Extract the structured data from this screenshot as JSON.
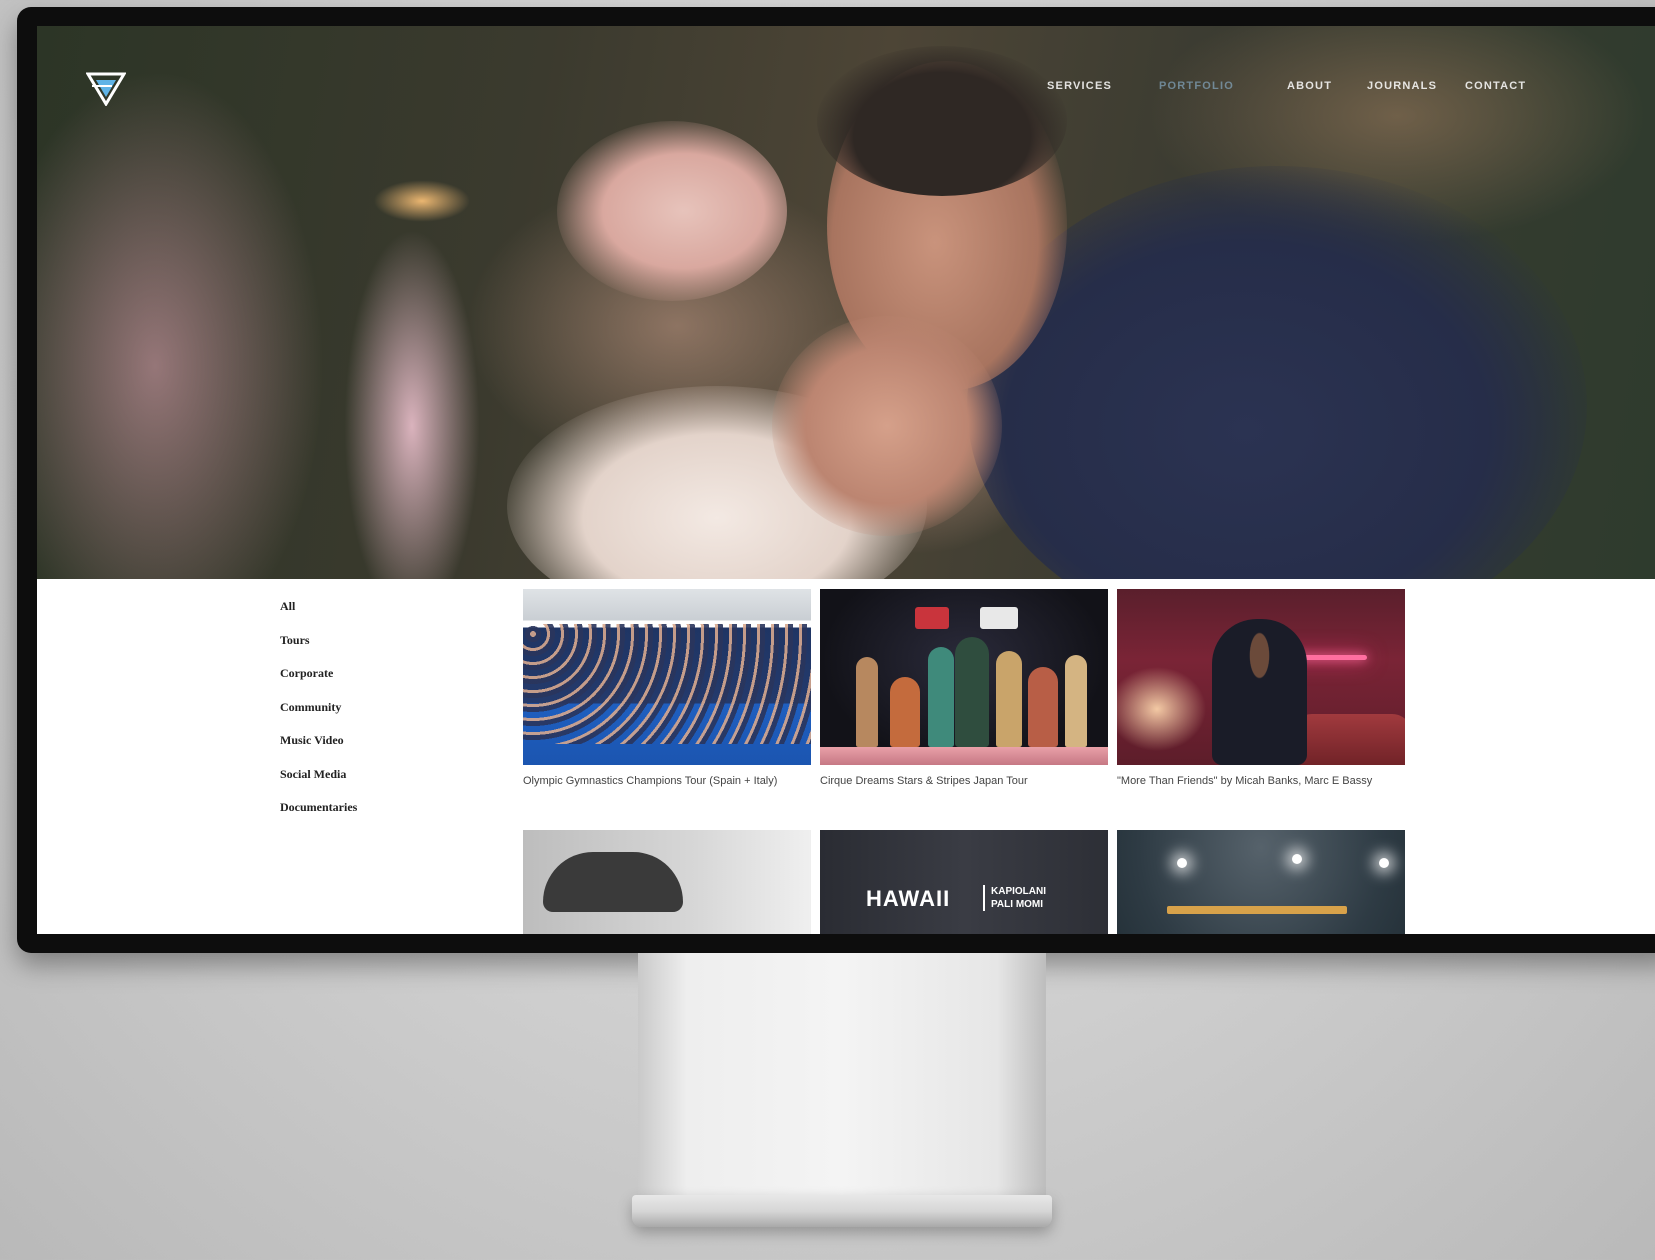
{
  "nav": {
    "items": [
      {
        "label": "SERVICES"
      },
      {
        "label": "PORTFOLIO"
      },
      {
        "label": "ABOUT"
      },
      {
        "label": "JOURNALS"
      },
      {
        "label": "CONTACT"
      }
    ],
    "active_index": 1
  },
  "filters": {
    "items": [
      {
        "label": "All"
      },
      {
        "label": "Tours"
      },
      {
        "label": "Corporate"
      },
      {
        "label": "Community"
      },
      {
        "label": "Music Video"
      },
      {
        "label": "Social Media"
      },
      {
        "label": "Documentaries"
      }
    ]
  },
  "portfolio": {
    "items": [
      {
        "title": "Olympic Gymnastics Champions Tour (Spain + Italy)"
      },
      {
        "title": "Cirque Dreams Stars & Stripes Japan Tour"
      },
      {
        "title": "\"More Than Friends\" by Micah Banks, Marc E Bassy"
      },
      {
        "title": ""
      },
      {
        "title": "",
        "thumb_title": "HAWAII",
        "thumb_sub_1": "KAPIOLANI",
        "thumb_sub_2": "PALI MOMI"
      },
      {
        "title": ""
      }
    ]
  },
  "colors": {
    "suit": "#262d49",
    "neon": "#ff6fa0",
    "nav_active": "#96c3e6"
  },
  "icons": {
    "logo": "stylized-v-logo"
  }
}
